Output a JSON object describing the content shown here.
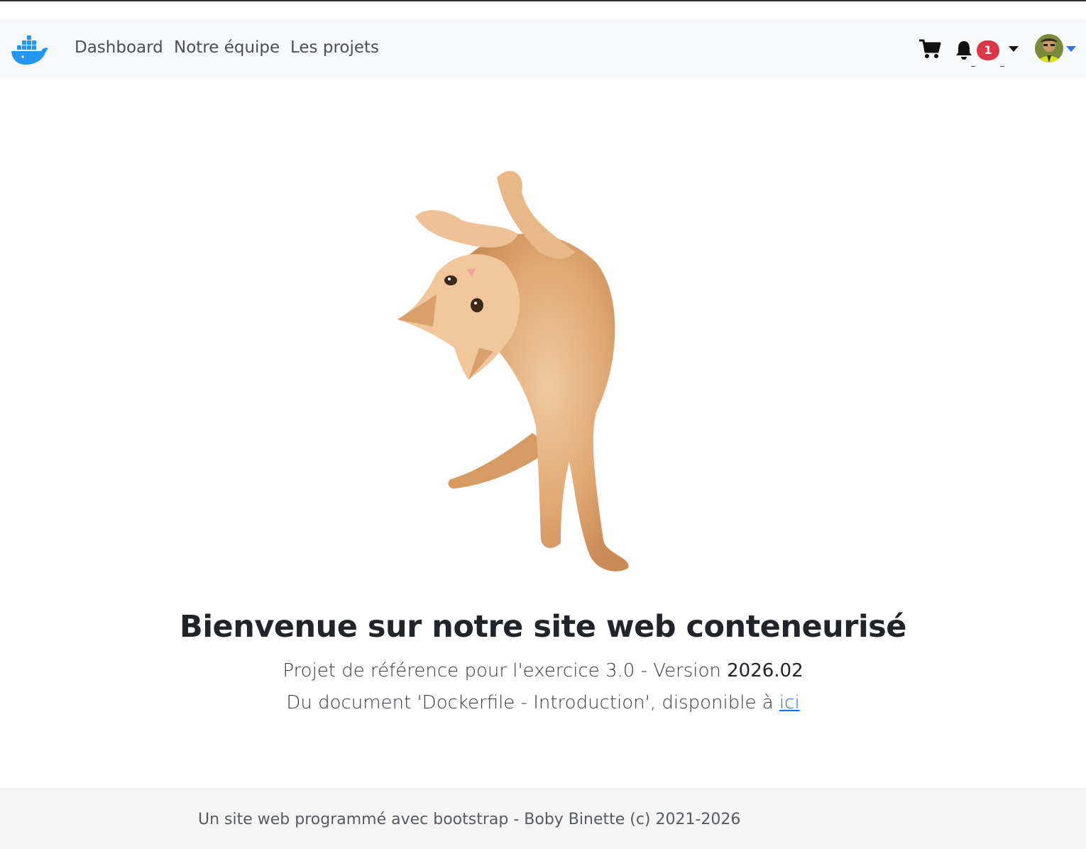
{
  "navbar": {
    "brand_icon": "docker-whale-icon",
    "links": [
      {
        "label": "Dashboard"
      },
      {
        "label": "Notre équipe"
      },
      {
        "label": "Les projets"
      }
    ],
    "cart_icon": "shopping-cart-icon",
    "notifications": {
      "icon": "bell-icon",
      "count": "1",
      "dash": "_"
    },
    "user_menu_icon": "avatar"
  },
  "hero": {
    "image_icon": "cat-image",
    "title": "Bienvenue sur notre site web conteneurisé",
    "line1_text": "Projet de référence pour l'exercice 3.0 - Version ",
    "line1_version": "2026.02",
    "line2_text": "Du document 'Dockerfile - Introduction', disponible à ",
    "line2_link": "ici"
  },
  "footer": {
    "text": "Un site web programmé avec bootstrap - Boby Binette (c) 2021-2026"
  },
  "colors": {
    "navbar_bg": "#f8f9fa",
    "badge": "#dc3545",
    "link": "#0d6efd",
    "docker_blue": "#2496ed",
    "footer_bg": "#f5f5f5"
  }
}
